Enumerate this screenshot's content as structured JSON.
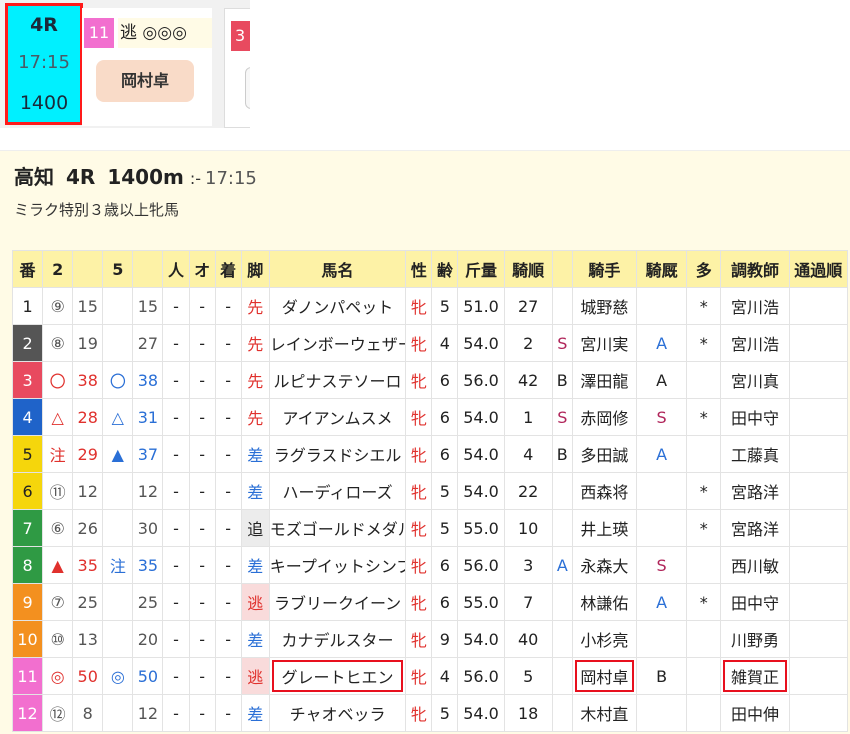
{
  "race_tile": {
    "race": "4R",
    "time": "17:15",
    "distance": "1400"
  },
  "pick": {
    "number": "11",
    "label": "逃 ◎◎◎",
    "jockey": "岡村卓"
  },
  "next_number": "3",
  "race": {
    "course": "高知",
    "race": "4R",
    "distance": "1400m",
    "colon": ":-",
    "time": "17:15",
    "condition": "ミラク特別３歳以上牝馬"
  },
  "colors": {
    "tile_bg": "#00f0ff",
    "highlight_border": "#e8101e",
    "panel_bg": "#fffbe6",
    "header_bg": "#fdf2a6"
  },
  "headers": [
    "番",
    "2",
    "",
    "5",
    "",
    "人",
    "オ",
    "着",
    "脚",
    "馬名",
    "性",
    "齢",
    "斤量",
    "騎順",
    "",
    "騎手",
    "騎厩",
    "多",
    "調教師",
    "通過順"
  ],
  "rows": [
    {
      "no": "1",
      "bg": "#ffffff",
      "fg": "#222",
      "m2": "⑨",
      "m2c": "gray",
      "n2": "15",
      "n2c": "gray",
      "m5": "",
      "m5c": "",
      "n5": "15",
      "n5c": "gray",
      "ninki": "-",
      "odds": "-",
      "chaku": "-",
      "style": "先",
      "stylec": "",
      "name": "ダノンパペット",
      "sex": "牝",
      "age": "5",
      "weight": "51.0",
      "order": "27",
      "orderc": "rank-gray",
      "sym": "",
      "symc": "",
      "jockey": "城野慈",
      "kk": "",
      "multi": "*",
      "trainer": "宮川浩",
      "pass": ""
    },
    {
      "no": "2",
      "bg": "#555555",
      "fg": "#fff",
      "m2": "⑧",
      "m2c": "gray",
      "n2": "19",
      "n2c": "gray",
      "m5": "",
      "m5c": "",
      "n5": "27",
      "n5c": "gray",
      "ninki": "-",
      "odds": "-",
      "chaku": "-",
      "style": "先",
      "stylec": "",
      "name": "レインボーウェザー",
      "sex": "牝",
      "age": "4",
      "weight": "54.0",
      "order": "2",
      "orderc": "rank-pink",
      "sym": "S",
      "symc": "sym-s",
      "jockey": "宮川実",
      "kk": "A",
      "kkc": "sym-a",
      "multi": "*",
      "trainer": "宮川浩",
      "pass": ""
    },
    {
      "no": "3",
      "bg": "#e84a5f",
      "fg": "#fff",
      "m2": "〇",
      "m2c": "red",
      "n2": "38",
      "n2c": "red",
      "m5": "〇",
      "m5c": "blue",
      "n5": "38",
      "n5c": "blue",
      "ninki": "-",
      "odds": "-",
      "chaku": "-",
      "style": "先",
      "stylec": "",
      "name": "ルピナステソーロ",
      "sex": "牝",
      "age": "6",
      "weight": "56.0",
      "order": "42",
      "orderc": "rank-gray",
      "sym": "B",
      "symc": "sym-b",
      "jockey": "澤田龍",
      "kk": "A",
      "kkc": "sym-b",
      "multi": "",
      "trainer": "宮川真",
      "pass": ""
    },
    {
      "no": "4",
      "bg": "#1f63c9",
      "fg": "#fff",
      "m2": "△",
      "m2c": "red",
      "n2": "28",
      "n2c": "red",
      "m5": "△",
      "m5c": "blue",
      "n5": "31",
      "n5c": "blue",
      "ninki": "-",
      "odds": "-",
      "chaku": "-",
      "style": "先",
      "stylec": "",
      "name": "アイアンムスメ",
      "sex": "牝",
      "age": "6",
      "weight": "54.0",
      "order": "1",
      "orderc": "rank-pink",
      "sym": "S",
      "symc": "sym-s",
      "jockey": "赤岡修",
      "kk": "S",
      "kkc": "sym-s",
      "multi": "*",
      "trainer": "田中守",
      "pass": ""
    },
    {
      "no": "5",
      "bg": "#f5d60c",
      "fg": "#222",
      "m2": "注",
      "m2c": "red",
      "n2": "29",
      "n2c": "red",
      "m5": "▲",
      "m5c": "blue",
      "n5": "37",
      "n5c": "blue",
      "ninki": "-",
      "odds": "-",
      "chaku": "-",
      "style": "差",
      "stylec": "sashi",
      "name": "ラグラスドシエル",
      "sex": "牝",
      "age": "6",
      "weight": "54.0",
      "order": "4",
      "orderc": "rank-peach",
      "sym": "B",
      "symc": "sym-b",
      "jockey": "多田誠",
      "kk": "A",
      "kkc": "sym-a",
      "multi": "",
      "trainer": "工藤真",
      "pass": ""
    },
    {
      "no": "6",
      "bg": "#f5d60c",
      "fg": "#222",
      "m2": "⑪",
      "m2c": "gray",
      "n2": "12",
      "n2c": "gray",
      "m5": "",
      "m5c": "",
      "n5": "12",
      "n5c": "gray",
      "ninki": "-",
      "odds": "-",
      "chaku": "-",
      "style": "差",
      "stylec": "sashi",
      "name": "ハーディローズ",
      "sex": "牝",
      "age": "5",
      "weight": "54.0",
      "order": "22",
      "orderc": "rank-gray",
      "sym": "",
      "symc": "",
      "jockey": "西森将",
      "kk": "",
      "multi": "*",
      "trainer": "宮路洋",
      "pass": ""
    },
    {
      "no": "7",
      "bg": "#2f9a44",
      "fg": "#fff",
      "m2": "⑥",
      "m2c": "gray",
      "n2": "26",
      "n2c": "gray",
      "m5": "",
      "m5c": "",
      "n5": "30",
      "n5c": "gray",
      "ninki": "-",
      "odds": "-",
      "chaku": "-",
      "style": "追",
      "stylec": "oi",
      "name": "モズゴールドメダル",
      "sex": "牝",
      "age": "5",
      "weight": "55.0",
      "order": "10",
      "orderc": "rank-white",
      "sym": "",
      "symc": "",
      "jockey": "井上瑛",
      "kk": "",
      "multi": "*",
      "trainer": "宮路洋",
      "pass": ""
    },
    {
      "no": "8",
      "bg": "#2f9a44",
      "fg": "#fff",
      "m2": "▲",
      "m2c": "red",
      "n2": "35",
      "n2c": "red",
      "m5": "注",
      "m5c": "blue",
      "n5": "35",
      "n5c": "blue",
      "ninki": "-",
      "odds": "-",
      "chaku": "-",
      "style": "差",
      "stylec": "sashi",
      "name": "キープイットシンプ",
      "sex": "牝",
      "age": "6",
      "weight": "56.0",
      "order": "3",
      "orderc": "rank-pink",
      "sym": "A",
      "symc": "sym-a",
      "jockey": "永森大",
      "kk": "S",
      "kkc": "sym-s",
      "multi": "",
      "trainer": "西川敏",
      "pass": ""
    },
    {
      "no": "9",
      "bg": "#f3901f",
      "fg": "#fff",
      "m2": "⑦",
      "m2c": "gray",
      "n2": "25",
      "n2c": "gray",
      "m5": "",
      "m5c": "",
      "n5": "25",
      "n5c": "gray",
      "ninki": "-",
      "odds": "-",
      "chaku": "-",
      "style": "逃",
      "stylec": "nige",
      "name": "ラブリークイーン",
      "sex": "牝",
      "age": "6",
      "weight": "55.0",
      "order": "7",
      "orderc": "rank-peach",
      "sym": "",
      "symc": "",
      "jockey": "林謙佑",
      "kk": "A",
      "kkc": "sym-a",
      "multi": "*",
      "trainer": "田中守",
      "pass": ""
    },
    {
      "no": "10",
      "bg": "#f3901f",
      "fg": "#fff",
      "m2": "⑩",
      "m2c": "gray",
      "n2": "13",
      "n2c": "gray",
      "m5": "",
      "m5c": "",
      "n5": "20",
      "n5c": "gray",
      "ninki": "-",
      "odds": "-",
      "chaku": "-",
      "style": "差",
      "stylec": "sashi",
      "name": "カナデルスター",
      "sex": "牝",
      "age": "9",
      "weight": "54.0",
      "order": "40",
      "orderc": "rank-gray",
      "sym": "",
      "symc": "",
      "jockey": "小杉亮",
      "kk": "",
      "multi": "",
      "trainer": "川野勇",
      "pass": ""
    },
    {
      "no": "11",
      "bg": "#f26fcf",
      "fg": "#fff",
      "m2": "◎",
      "m2c": "red",
      "n2": "50",
      "n2c": "red",
      "m5": "◎",
      "m5c": "blue",
      "n5": "50",
      "n5c": "blue",
      "ninki": "-",
      "odds": "-",
      "chaku": "-",
      "style": "逃",
      "stylec": "nige",
      "name": "グレートヒエン",
      "sex": "牝",
      "age": "4",
      "weight": "56.0",
      "order": "5",
      "orderc": "rank-peach",
      "sym": "",
      "symc": "",
      "jockey": "岡村卓",
      "kk": "B",
      "kkc": "sym-b",
      "multi": "",
      "trainer": "雑賀正",
      "pass": "",
      "boxed": true
    },
    {
      "no": "12",
      "bg": "#f26fcf",
      "fg": "#fff",
      "m2": "⑫",
      "m2c": "gray",
      "n2": "8",
      "n2c": "gray",
      "m5": "",
      "m5c": "",
      "n5": "12",
      "n5c": "gray",
      "ninki": "-",
      "odds": "-",
      "chaku": "-",
      "style": "差",
      "stylec": "sashi",
      "name": "チャオベッラ",
      "sex": "牝",
      "age": "5",
      "weight": "54.0",
      "order": "18",
      "orderc": "rank-gray",
      "sym": "",
      "symc": "",
      "jockey": "木村直",
      "kk": "",
      "multi": "",
      "trainer": "田中伸",
      "pass": ""
    }
  ]
}
